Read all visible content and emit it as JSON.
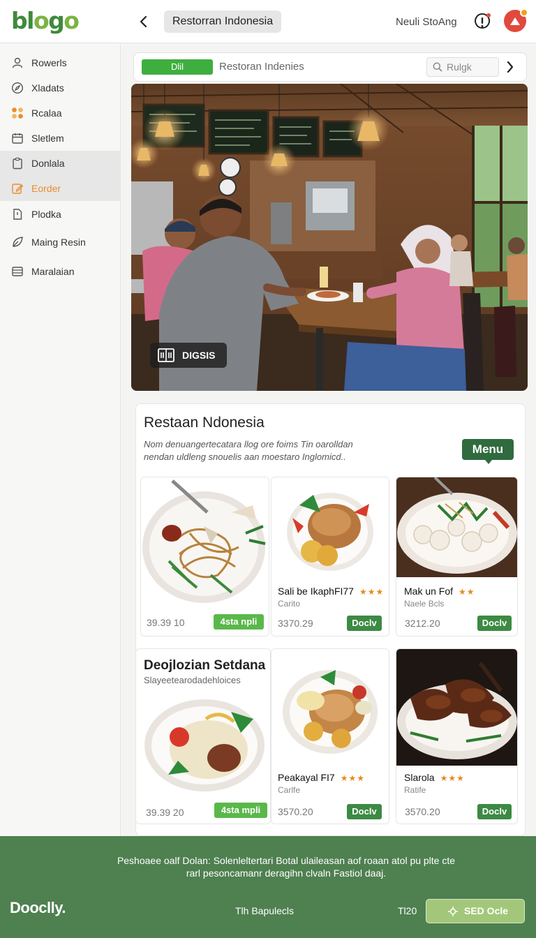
{
  "header": {
    "logo": "blogo",
    "title": "Restorran Indonesia",
    "user_label": "Neuli StoAng"
  },
  "sidebar": {
    "items": [
      {
        "label": "Rowerls",
        "icon": "user-icon"
      },
      {
        "label": "Xladats",
        "icon": "compass-icon"
      },
      {
        "label": "Rcalaa",
        "icon": "grid-icon"
      },
      {
        "label": "Sletlem",
        "icon": "calendar-icon"
      },
      {
        "label": "Donlala",
        "icon": "clipboard-icon"
      },
      {
        "label": "Eorder",
        "icon": "edit-icon"
      },
      {
        "label": "Plodka",
        "icon": "document-icon"
      },
      {
        "label": "Maing Resin",
        "icon": "leaf-icon"
      },
      {
        "label": "Maralaian",
        "icon": "layers-icon"
      }
    ],
    "active_color": "#e98d2f"
  },
  "toolbar": {
    "button_label": "Dlil",
    "breadcrumb": "Restoran Indenies",
    "search_placeholder": "Rulgk"
  },
  "hero": {
    "badge_label": "DIGSIS"
  },
  "restaurant": {
    "title": "Restaan Ndonesia",
    "description": "Nom denuangertecatara llog ore foims Tin oarolldan nendan uldleng snouelis aan moestaro Inglomicd..",
    "menu_label": "Menu"
  },
  "tiles_row1": [
    {
      "price": "39.39 10",
      "button": "4sta npli",
      "icon": "noodle-plate-icon"
    },
    {
      "name": "Sali be IkaphFI77",
      "stars": "★★★",
      "sub": "Carito",
      "price": "3370.29",
      "button": "Doclv",
      "icon": "grilled-chicken-icon"
    },
    {
      "name": "Mak un Fof",
      "stars": "★★",
      "sub": "Naele Bcls",
      "price": "3212.20",
      "button": "Doclv",
      "icon": "dumpling-plate-icon"
    }
  ],
  "featured": {
    "title": "Deojlozian Setdana",
    "subtitle": "Slayeetearodadehloices"
  },
  "tiles_row2": [
    {
      "price": "39.39 20",
      "button": "4sta mpli",
      "icon": "rice-plate-icon"
    },
    {
      "name": "Peakayal FI7",
      "stars": "★★★",
      "sub": "Carlfe",
      "price": "3570.20",
      "button": "Doclv",
      "icon": "roast-chicken-icon"
    },
    {
      "name": "Slarola",
      "stars": "★★★",
      "sub": "Ratife",
      "price": "3570.20",
      "button": "Doclv",
      "icon": "satay-plate-icon"
    }
  ],
  "footer": {
    "text": "Peshoaee oalf Dolan: Solenleltertari Botal ulaileasan aof roaan atol pu plte cte rarl pesoncamanr deragihn clvaln Fastiol daaj.",
    "logo": "Dooclly.",
    "link": "Tlh Bapulecls",
    "count": "Tl20",
    "button_label": "SED Ocle"
  }
}
